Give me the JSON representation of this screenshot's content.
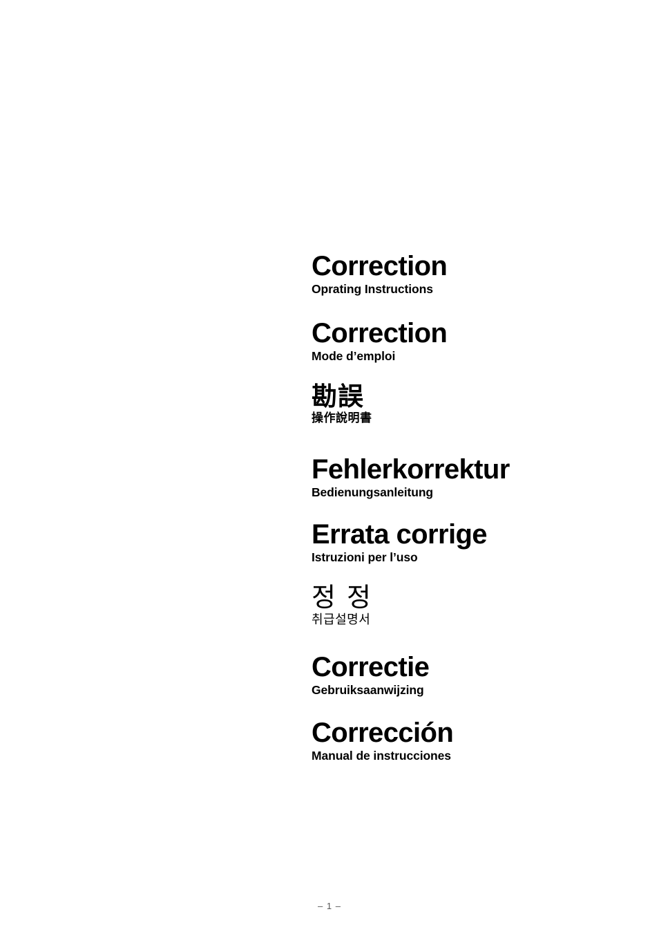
{
  "document": {
    "page_background": "#ffffff",
    "text_color": "#000000",
    "footer_color": "#555555"
  },
  "sections": [
    {
      "id": "english",
      "title": "Correction",
      "subtitle": "Oprating Instructions"
    },
    {
      "id": "french",
      "title": "Correction",
      "subtitle": "Mode d’emploi"
    },
    {
      "id": "chinese",
      "title": "勘誤",
      "subtitle": "操作說明書"
    },
    {
      "id": "german",
      "title": "Fehlerkorrektur",
      "subtitle": "Bedienungsanleitung"
    },
    {
      "id": "italian",
      "title": "Errata corrige",
      "subtitle": "Istruzioni per l’uso"
    },
    {
      "id": "korean",
      "title": "정 정",
      "subtitle": "취급설명서"
    },
    {
      "id": "dutch",
      "title": "Correctie",
      "subtitle": "Gebruiksaanwijzing"
    },
    {
      "id": "spanish",
      "title": "Corrección",
      "subtitle": "Manual de instrucciones"
    }
  ],
  "footer": {
    "folio": "– 1 –"
  }
}
